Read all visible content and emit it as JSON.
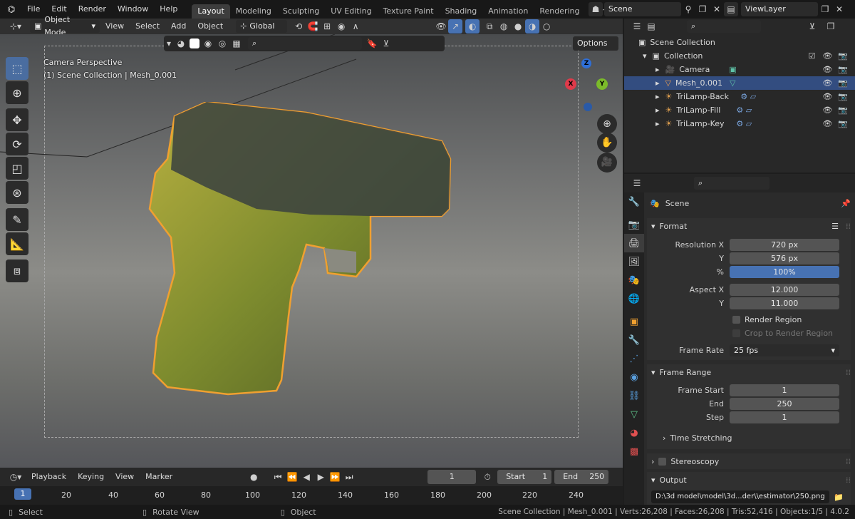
{
  "topbar": {
    "menus": [
      "File",
      "Edit",
      "Render",
      "Window",
      "Help"
    ],
    "workspaces": [
      "Layout",
      "Modeling",
      "Sculpting",
      "UV Editing",
      "Texture Paint",
      "Shading",
      "Animation",
      "Rendering",
      "Compos"
    ],
    "scene": "Scene",
    "viewlayer": "ViewLayer"
  },
  "viewport": {
    "mode": "Object Mode",
    "menus": [
      "View",
      "Select",
      "Add",
      "Object"
    ],
    "orientation": "Global",
    "options": "Options",
    "camera_label": "Camera Perspective",
    "collection_label": "(1) Scene Collection | Mesh_0.001",
    "gizmo": {
      "x": "X",
      "y": "Y",
      "z": "Z"
    }
  },
  "outliner": {
    "root": "Scene Collection",
    "collection": "Collection",
    "items": [
      {
        "name": "Camera"
      },
      {
        "name": "Mesh_0.001"
      },
      {
        "name": "TriLamp-Back"
      },
      {
        "name": "TriLamp-Fill"
      },
      {
        "name": "TriLamp-Key"
      }
    ]
  },
  "properties": {
    "context": "Scene",
    "format": {
      "title": "Format",
      "res_x_label": "Resolution X",
      "res_x": "720 px",
      "res_y_label": "Y",
      "res_y": "576 px",
      "pct_label": "%",
      "pct": "100%",
      "aspect_x_label": "Aspect X",
      "aspect_x": "12.000",
      "aspect_y_label": "Y",
      "aspect_y": "11.000",
      "render_region": "Render Region",
      "crop": "Crop to Render Region",
      "frame_rate_label": "Frame Rate",
      "frame_rate": "25 fps"
    },
    "frame_range": {
      "title": "Frame Range",
      "start_label": "Frame Start",
      "start": "1",
      "end_label": "End",
      "end": "250",
      "step_label": "Step",
      "step": "1",
      "time_stretching": "Time Stretching"
    },
    "stereoscopy": "Stereoscopy",
    "output": {
      "title": "Output",
      "path": "D:\\3d model\\model\\3d...der\\\\estimator\\250.png"
    }
  },
  "timeline": {
    "menus": [
      "Playback",
      "Keying",
      "View",
      "Marker"
    ],
    "current_frame": "1",
    "start_label": "Start",
    "start": "1",
    "end_label": "End",
    "end": "250",
    "ruler": [
      "1",
      "20",
      "40",
      "60",
      "80",
      "100",
      "120",
      "140",
      "160",
      "180",
      "200",
      "220",
      "240"
    ]
  },
  "status": {
    "select": "Select",
    "rotate": "Rotate View",
    "object": "Object",
    "info": "Scene Collection | Mesh_0.001 | Verts:26,208 | Faces:26,208 | Tris:52,416 | Objects:1/5 | 4.0.2"
  },
  "colors": {
    "accent": "#4772b3",
    "selection": "#334d80",
    "outline": "#f0a030"
  }
}
